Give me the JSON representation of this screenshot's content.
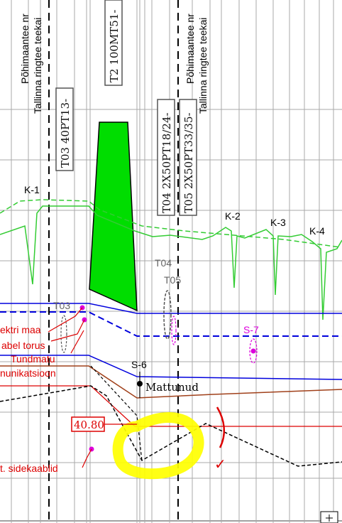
{
  "vertical_road_labels": {
    "left_line1": "Põhimaantee nr",
    "left_line2": "Tallinna ringtee teekai",
    "right_line1": "Põhimaantee nr",
    "right_line2": "Tallinna ringtee teekai"
  },
  "pipe_boxes": {
    "t03": "T03 40PT13-",
    "t02": "T2 100MT51-",
    "t04": "T04 2X50PT18/24-",
    "t05": "T05 2X50PT33/35-"
  },
  "profile_labels": {
    "k1": "K-1",
    "k2": "K-2",
    "k3": "K-3",
    "k4": "K-4",
    "t04": "T04",
    "t05": "T05",
    "t03": "T03",
    "s7": "S-7",
    "s6": "S-6",
    "mattunud": "Mattunud"
  },
  "legend_labels": {
    "elektri_maa": "ektri maa",
    "kabel_torus": "abel torus",
    "tundmatu": "Tundmatu",
    "kommunikatsioon": "nunikatsioon",
    "sidekaablid": "t. sidekaablid"
  },
  "elevation_box": "40.80",
  "annotation_marks": {
    "check": "✓"
  },
  "colors": {
    "grid": "#9a9a9a",
    "green_fill": "#00dd00",
    "green_line": "#33cc33",
    "blue": "#0000dd",
    "red": "#dd0000",
    "brown": "#a0401a",
    "magenta": "#dd00dd",
    "highlight": "#ffff00"
  }
}
